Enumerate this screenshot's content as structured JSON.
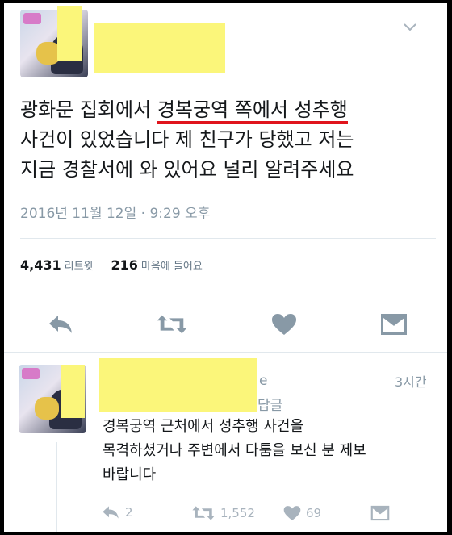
{
  "tweet": {
    "text_lines": [
      {
        "before": "광화문 집회에서 ",
        "highlight": "경복궁역 쪽에서 성추행",
        "after": ""
      },
      {
        "before": "사건이 있었습니다 제 친구가 당했고 저는",
        "highlight": "",
        "after": ""
      },
      {
        "before": "지금 경찰서에 와 있어요 널리 알려주세요",
        "highlight": "",
        "after": ""
      }
    ],
    "timestamp": "2016년 11월 12일 · 9:29 오후",
    "retweet_count": "4,431",
    "retweet_label": "리트윗",
    "like_count": "216",
    "like_label": "마음에 들어요"
  },
  "reply": {
    "name_tail": "e",
    "handle_tail": "답글",
    "time": "3시간",
    "text_lines": [
      "경복궁역 근처에서 성추행 사건을",
      "목격하셨거나 주변에서 다툼을 보신 분 제보",
      "바랍니다"
    ],
    "reply_count": "2",
    "retweet_count": "1,552",
    "like_count": "69"
  },
  "colors": {
    "underline": "#e0141c",
    "redaction": "#fbf67a",
    "muted": "#8899a6",
    "icon": "#a8b3bd"
  }
}
